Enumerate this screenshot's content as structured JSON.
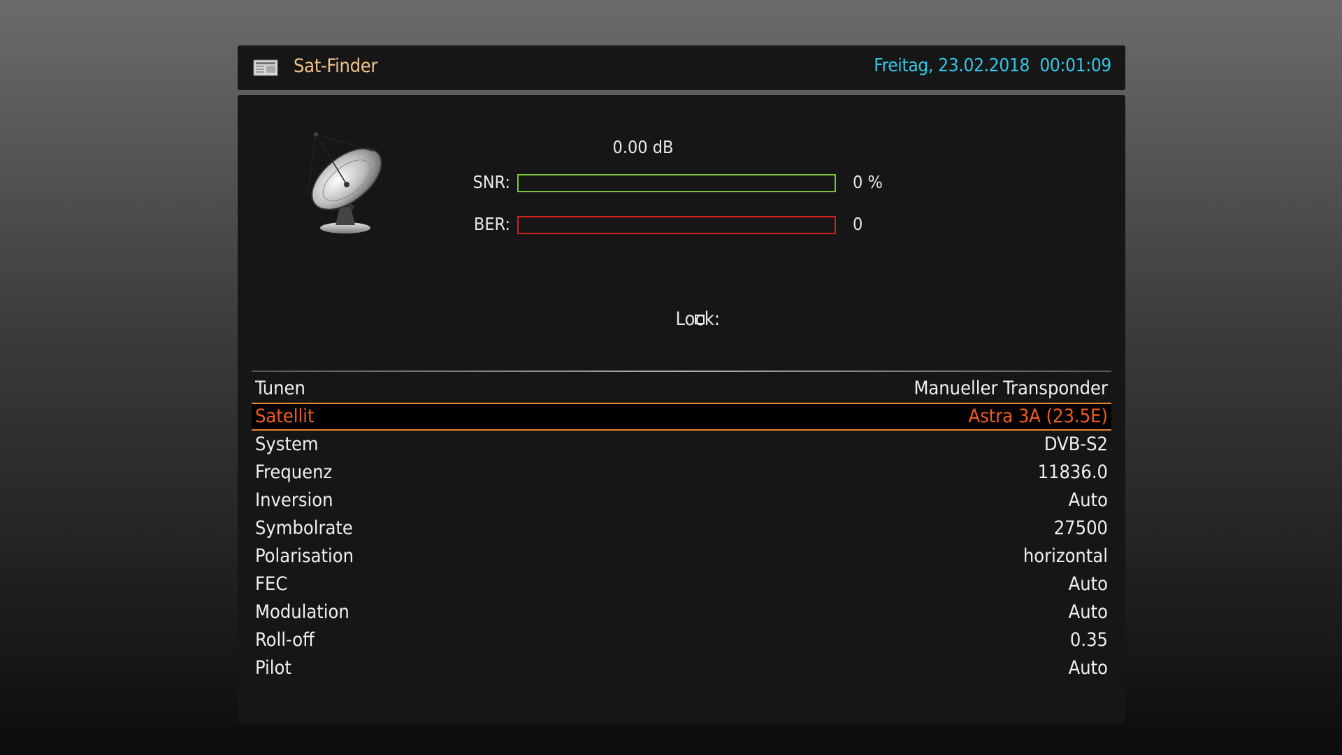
{
  "header": {
    "icon": "menu-card-icon",
    "title": "Sat-Finder",
    "clock": "Freitag, 23.02.2018  00:01:09"
  },
  "signal": {
    "icon": "satellite-dish-icon",
    "db_value": "0.00 dB",
    "snr": {
      "label": "SNR:",
      "value_text": "0 %",
      "level_fraction": 0.0,
      "color": "#7cc63a"
    },
    "ber": {
      "label": "BER:",
      "value_text": "0",
      "level_fraction": 0.0,
      "color": "#d42020"
    },
    "lock": {
      "label": "Lock:",
      "locked": false
    }
  },
  "settings": [
    {
      "label": "Tunen",
      "value": "Manueller Transponder"
    },
    {
      "label": "Satellit",
      "value": "Astra 3A (23.5E)",
      "selected": true
    },
    {
      "label": "System",
      "value": "DVB-S2"
    },
    {
      "label": "Frequenz",
      "value": "11836.0"
    },
    {
      "label": "Inversion",
      "value": "Auto"
    },
    {
      "label": "Symbolrate",
      "value": "27500"
    },
    {
      "label": "Polarisation",
      "value": "horizontal"
    },
    {
      "label": "FEC",
      "value": "Auto"
    },
    {
      "label": "Modulation",
      "value": "Auto"
    },
    {
      "label": "Roll-off",
      "value": "0.35"
    },
    {
      "label": "Pilot",
      "value": "Auto"
    }
  ],
  "colors": {
    "title": "#f2c48a",
    "clock": "#30c8e8",
    "selected_text": "#f25c1e",
    "selected_border": "#e8852a"
  }
}
